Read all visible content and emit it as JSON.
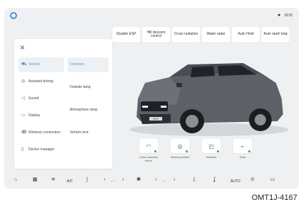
{
  "status": {
    "bluetooth": "✱",
    "time": "16:51"
  },
  "top_buttons": [
    "Disable ESP",
    "Hill descent control",
    "Cross radiation",
    "Water radar",
    "Auto Hold",
    "Auto start/ stop"
  ],
  "panel": {
    "close": "×",
    "left_menu": [
      {
        "label": "Vehicle",
        "icon": "car-icon",
        "glyph": "⛟",
        "active": true
      },
      {
        "label": "Assisted driving",
        "icon": "steering-icon",
        "glyph": "◎",
        "active": false
      },
      {
        "label": "Sound",
        "icon": "speaker-icon",
        "glyph": "◁",
        "active": false
      },
      {
        "label": "Display",
        "icon": "display-icon",
        "glyph": "▭",
        "active": false
      },
      {
        "label": "Wireless connection",
        "icon": "wireless-icon",
        "glyph": "ↂ",
        "active": false
      },
      {
        "label": "Device manager",
        "icon": "device-icon",
        "glyph": "▯",
        "active": false
      }
    ],
    "right_menu": [
      {
        "label": "Common",
        "active": true
      },
      {
        "label": "Outside lamp",
        "active": false
      },
      {
        "label": "Atmosphere lamp",
        "active": false
      },
      {
        "label": "Vehicle lock",
        "active": false
      }
    ]
  },
  "vehicle": {
    "plate": "ROX"
  },
  "tiles": [
    {
      "label": "Outer rearview mirror",
      "icon": "mirror-icon",
      "glyph": "◠"
    },
    {
      "label": "Steering wheel",
      "icon": "steering-wheel-icon",
      "glyph": "◎"
    },
    {
      "label": "Window",
      "icon": "window-icon",
      "glyph": "◰"
    },
    {
      "label": "Seat",
      "icon": "seat-icon",
      "glyph": "⌐"
    }
  ],
  "dock": {
    "home": "⌂",
    "apps": "▦",
    "ac_label": "A/C",
    "auto_label": "AUTO",
    "left_temp": "- -",
    "right_temp": "- -"
  },
  "caption": "OMT1J-4167"
}
